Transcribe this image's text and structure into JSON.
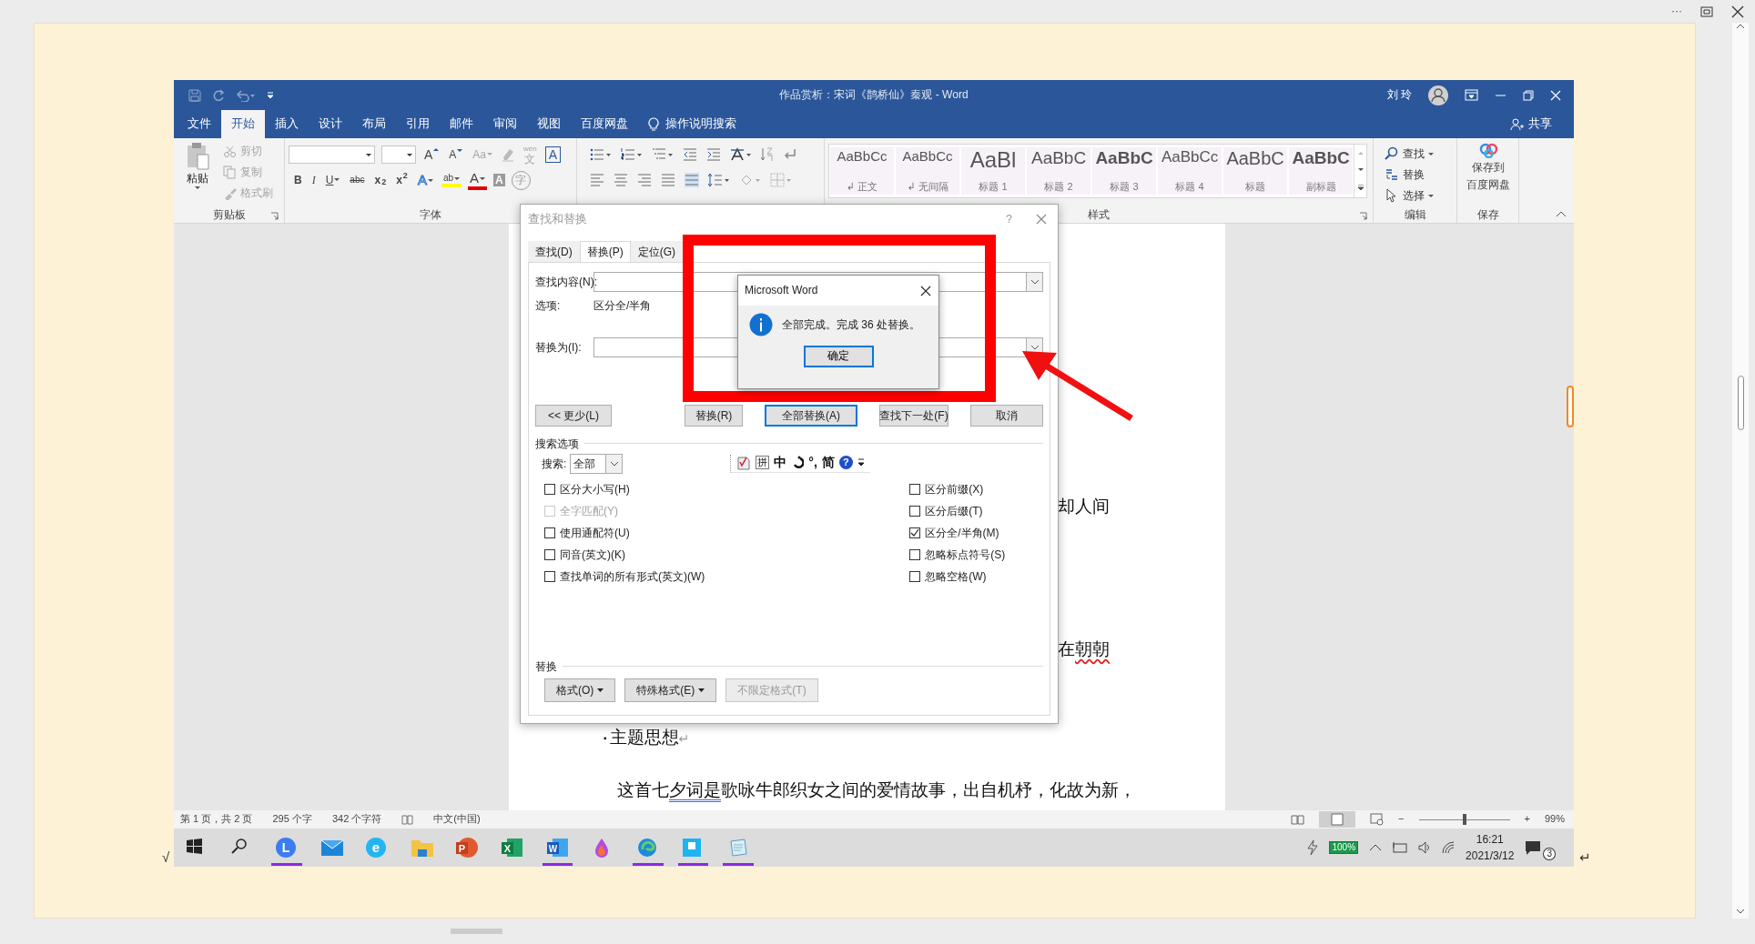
{
  "window": {
    "menu_glyph": "···"
  },
  "page_marks": {
    "left": "√",
    "right": "↵"
  },
  "word": {
    "title": "作品赏析：宋词《鹊桥仙》秦观 - Word",
    "user": "刘 玲",
    "tabs": [
      {
        "label": "文件",
        "selected": false
      },
      {
        "label": "开始",
        "selected": true
      },
      {
        "label": "插入",
        "selected": false
      },
      {
        "label": "设计",
        "selected": false
      },
      {
        "label": "布局",
        "selected": false
      },
      {
        "label": "引用",
        "selected": false
      },
      {
        "label": "邮件",
        "selected": false
      },
      {
        "label": "审阅",
        "selected": false
      },
      {
        "label": "视图",
        "selected": false
      },
      {
        "label": "百度网盘",
        "selected": false
      }
    ],
    "tell_me": "操作说明搜索",
    "share": "共享",
    "ribbon": {
      "clipboard": {
        "label": "剪贴板",
        "paste": "粘贴",
        "items": [
          {
            "label": "剪切",
            "disabled": true
          },
          {
            "label": "复制",
            "disabled": true
          },
          {
            "label": "格式刷",
            "disabled": true
          }
        ]
      },
      "font": {
        "label": "字体",
        "row1": [
          {
            "kind": "grow",
            "text": "A"
          },
          {
            "kind": "shrink",
            "text": "A"
          },
          {
            "kind": "case",
            "text": "Aa"
          },
          {
            "kind": "clear"
          },
          {
            "kind": "phonetic",
            "ruby": "wén",
            "text": "文"
          },
          {
            "kind": "boxed",
            "text": "A"
          }
        ],
        "row2": [
          {
            "kind": "bold",
            "text": "B"
          },
          {
            "kind": "italic",
            "text": "I"
          },
          {
            "kind": "underline",
            "text": "U"
          },
          {
            "kind": "strike",
            "text": "abc"
          },
          {
            "kind": "script",
            "text": "x$_{2}$"
          },
          {
            "kind": "script",
            "text": "x$^{2}$"
          },
          {
            "kind": "effects",
            "text": "A"
          },
          {
            "kind": "highlight",
            "text": "ab"
          },
          {
            "kind": "color",
            "text": "A"
          },
          {
            "kind": "shaded",
            "text": "A"
          },
          {
            "kind": "circled",
            "text": "字"
          }
        ]
      },
      "styles": {
        "label": "样式",
        "items": [
          {
            "preview": "AaBbCc",
            "name": "↲ 正文",
            "kind": "body"
          },
          {
            "preview": "AaBbCc",
            "name": "↲ 无间隔",
            "kind": "body"
          },
          {
            "preview": "AaBl",
            "name": "标题 1",
            "kind": "heading1"
          },
          {
            "preview": "AaBbC",
            "name": "标题 2",
            "kind": "heading2"
          },
          {
            "preview": "AaBbC",
            "name": "标题 3",
            "kind": "heading3"
          },
          {
            "preview": "AaBbCc",
            "name": "标题 4",
            "kind": "heading4"
          },
          {
            "preview": "AaBbC",
            "name": "标题",
            "kind": "title"
          },
          {
            "preview": "AaBbC",
            "name": "副标题",
            "kind": "subtitle"
          }
        ]
      },
      "editing": {
        "label": "编辑",
        "items": [
          {
            "kind": "find",
            "label": "查找",
            "caret": true
          },
          {
            "kind": "replace",
            "label": "替换",
            "caret": false
          },
          {
            "kind": "select",
            "label": "选择",
            "caret": true
          }
        ]
      },
      "save": {
        "label": "保存",
        "button_lines": [
          "保存到",
          "百度网盘"
        ]
      }
    },
    "document": {
      "paragraphs": [
        {
          "kind": "fragment",
          "segments": [
            {
              "text": "却人间",
              "spelling_error": false,
              "grammar_error": false
            }
          ]
        },
        {
          "kind": "fragment",
          "segments": [
            {
              "text": "在",
              "spelling_error": false,
              "grammar_error": false
            },
            {
              "text": "朝朝",
              "spelling_error": true,
              "grammar_error": false
            }
          ]
        },
        {
          "kind": "heading",
          "bullet": "▪",
          "mark": "↵",
          "segments": [
            {
              "text": "主题思想",
              "spelling_error": false,
              "grammar_error": false
            }
          ]
        },
        {
          "kind": "body",
          "segments": [
            {
              "text": "这首七",
              "spelling_error": false,
              "grammar_error": false
            },
            {
              "text": "夕词是",
              "spelling_error": false,
              "grammar_error": true
            },
            {
              "text": "歌咏牛郎织女之间的爱情故事，出自机杼，化故为新，",
              "spelling_error": false,
              "grammar_error": false
            }
          ]
        }
      ]
    },
    "status": {
      "items": [
        "第 1 页，共 2 页",
        "295 个字",
        "342 个字符"
      ],
      "language": "中文(中国)",
      "zoom_out": "−",
      "zoom_in": "+",
      "zoom": "99%",
      "zoom_slider": {
        "level": 0.5
      }
    },
    "taskbar": {
      "apps": [
        {
          "kind": "start",
          "running": false
        },
        {
          "kind": "search",
          "running": false
        },
        {
          "kind": "circle-app",
          "glyph": "L",
          "running": true
        },
        {
          "kind": "mail",
          "running": false
        },
        {
          "kind": "e-browser",
          "glyph": "e",
          "running": false
        },
        {
          "kind": "folder",
          "running": false
        },
        {
          "kind": "slides",
          "glyph": "P",
          "running": false
        },
        {
          "kind": "sheet",
          "glyph": "X",
          "running": false
        },
        {
          "kind": "doc",
          "glyph": "W",
          "running": true
        },
        {
          "kind": "paint",
          "running": false
        },
        {
          "kind": "edge",
          "running": true
        },
        {
          "kind": "square-app",
          "running": true
        },
        {
          "kind": "notepad",
          "running": true
        }
      ],
      "battery": "100%",
      "time": "16:21",
      "date": "2021/3/12",
      "notifications": "3"
    }
  },
  "dialog": {
    "title": "查找和替换",
    "help": "?",
    "tabs": [
      {
        "label": "查找(D)",
        "selected": false
      },
      {
        "label": "替换(P)",
        "selected": true
      },
      {
        "label": "定位(G)",
        "selected": false
      }
    ],
    "find_label": "查找内容(N):",
    "options_label": "选项:",
    "options_value": "区分全/半角",
    "replace_label": "替换为(I):",
    "buttons": [
      {
        "label": "<< 更少(L)",
        "default": false
      },
      {
        "label": "替换(R)",
        "default": false
      },
      {
        "label": "全部替换(A)",
        "default": true
      },
      {
        "label": "查找下一处(F)",
        "default": false
      },
      {
        "label": "取消",
        "default": false
      }
    ],
    "search_section": "搜索选项",
    "search_label": "搜索:",
    "search_value": "全部",
    "toolbar": [
      {
        "kind": "doc-check"
      },
      {
        "kind": "boxed",
        "text": "拼"
      },
      {
        "kind": "text",
        "text": "中"
      },
      {
        "kind": "swirl"
      },
      {
        "kind": "text",
        "text": "°,"
      },
      {
        "kind": "text",
        "text": "简"
      },
      {
        "kind": "help",
        "text": "?"
      },
      {
        "kind": "more"
      }
    ],
    "left_options": [
      {
        "label": "区分大小写(H)",
        "checked": false,
        "disabled": false
      },
      {
        "label": "全字匹配(Y)",
        "checked": false,
        "disabled": true
      },
      {
        "label": "使用通配符(U)",
        "checked": false,
        "disabled": false
      },
      {
        "label": "同音(英文)(K)",
        "checked": false,
        "disabled": false
      },
      {
        "label": "查找单词的所有形式(英文)(W)",
        "checked": false,
        "disabled": false
      }
    ],
    "right_options": [
      {
        "label": "区分前缀(X)",
        "checked": false,
        "disabled": false
      },
      {
        "label": "区分后缀(T)",
        "checked": false,
        "disabled": false
      },
      {
        "label": "区分全/半角(M)",
        "checked": true,
        "disabled": false
      },
      {
        "label": "忽略标点符号(S)",
        "checked": false,
        "disabled": false
      },
      {
        "label": "忽略空格(W)",
        "checked": false,
        "disabled": false
      }
    ],
    "replace_section": "替换",
    "format_buttons": [
      {
        "label": "格式(O)",
        "caret": true,
        "disabled": false
      },
      {
        "label": "特殊格式(E)",
        "caret": true,
        "disabled": false
      },
      {
        "label": "不限定格式(T)",
        "caret": false,
        "disabled": true
      }
    ]
  },
  "message_box": {
    "title": "Microsoft Word",
    "message": "全部完成。完成 36 处替换。",
    "ok": "确定"
  }
}
